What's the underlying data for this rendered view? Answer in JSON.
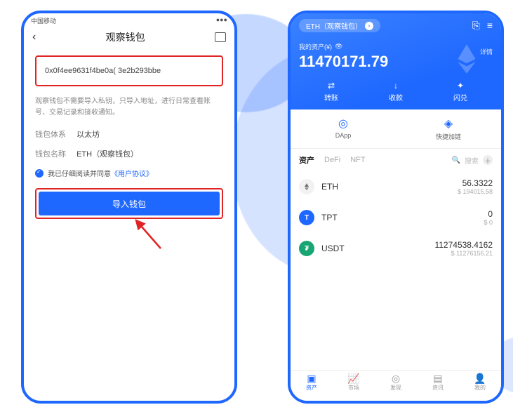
{
  "left": {
    "status": {
      "carrier": "中国移动",
      "signal": "●●●"
    },
    "title": "观察钱包",
    "address": "0x0f4ee9631f4be0a(                         3e2b293bbe",
    "note": "观察钱包不需要导入私钥，只导入地址，进行日常查看账号、交易记录和接收通知。",
    "chain_label": "钱包体系",
    "chain_value": "以太坊",
    "name_label": "钱包名称",
    "name_value": "ETH（观察钱包）",
    "agree_prefix": "我已仔细阅读并同意",
    "agree_link": "《用户协议》",
    "import_btn": "导入钱包"
  },
  "right": {
    "pill": "ETH（观察钱包）",
    "asset_label": "我的资产(¥)",
    "asset_value": "11470171.79",
    "detail": "详情",
    "actions": {
      "transfer": "转账",
      "receive": "收款",
      "swap": "闪兑"
    },
    "shortcuts": {
      "dapp": "DApp",
      "chain": "快捷加链"
    },
    "tabs": {
      "assets": "资产",
      "defi": "DeFi",
      "nft": "NFT"
    },
    "search_placeholder": "搜索",
    "assets": [
      {
        "symbol": "ETH",
        "amount": "56.3322",
        "fiat": "$ 194015.58"
      },
      {
        "symbol": "TPT",
        "amount": "0",
        "fiat": "$ 0"
      },
      {
        "symbol": "USDT",
        "amount": "11274538.4162",
        "fiat": "$ 11276156.21"
      }
    ],
    "nav": {
      "assets": "资产",
      "market": "市场",
      "discover": "发现",
      "news": "资讯",
      "mine": "我的"
    }
  }
}
